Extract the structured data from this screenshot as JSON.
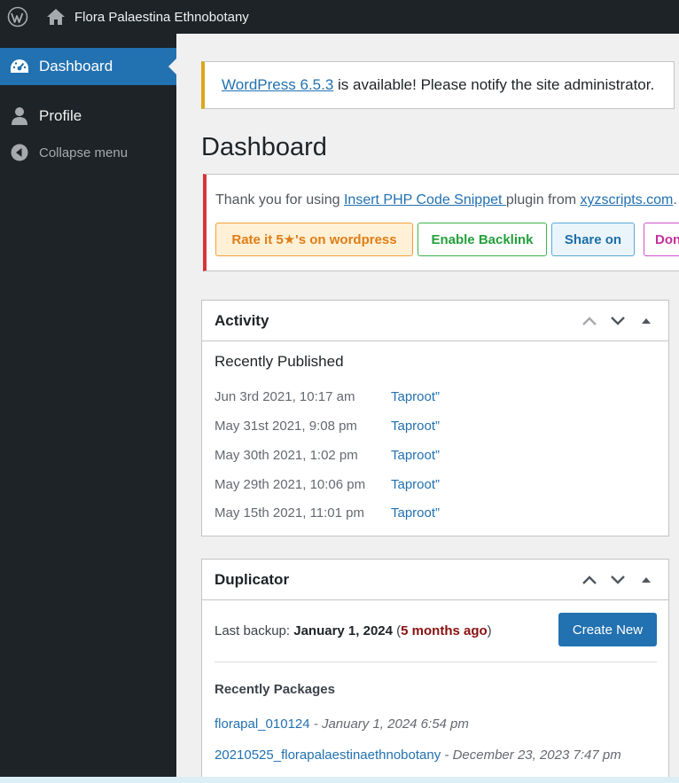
{
  "adminbar": {
    "site_name": "Flora Palaestina Ethnobotany",
    "icons": [
      "wordpress-logo-icon",
      "home-icon"
    ]
  },
  "sidebar": {
    "items": [
      {
        "label": "Dashboard",
        "icon": "dashboard-icon",
        "current": true
      },
      {
        "label": "Profile",
        "icon": "user-icon"
      },
      {
        "label": "Collapse menu",
        "icon": "collapse-icon"
      }
    ]
  },
  "update_notice": {
    "link": "WordPress 6.5.3",
    "text": " is available! Please notify the site administrator."
  },
  "page_title": "Dashboard",
  "plugin_notice": {
    "text_before": "Thank you for using ",
    "plugin_link": "Insert PHP Code Snippet ",
    "text_middle": "plugin from ",
    "site_link": "xyzscripts.com",
    "text_after": ".",
    "buttons": {
      "rate": "Rate it 5★'s on wordpress",
      "backlink": "Enable Backlink",
      "share": "Share on",
      "donate": "Don"
    }
  },
  "activity": {
    "title": "Activity",
    "subtitle": "Recently Published",
    "rows": [
      {
        "date": "Jun 3rd 2021, 10:17 am",
        "title": "Taproot”"
      },
      {
        "date": "May 31st 2021, 9:08 pm",
        "title": "Taproot”"
      },
      {
        "date": "May 30th 2021, 1:02 pm",
        "title": "Taproot”"
      },
      {
        "date": "May 29th 2021, 10:06 pm",
        "title": "Taproot”"
      },
      {
        "date": "May 15th 2021, 11:01 pm",
        "title": "Taproot”"
      }
    ]
  },
  "duplicator": {
    "title": "Duplicator",
    "backup_label": "Last backup: ",
    "backup_date": "January 1, 2024",
    "open_paren": " (",
    "ago": "5 months ago",
    "close_paren": ")",
    "create_button": "Create New",
    "recent_title": "Recently Packages",
    "packages": [
      {
        "name": "florapal_010124",
        "sep": " - ",
        "date": "January 1, 2024 6:54 pm"
      },
      {
        "name": "20210525_florapalaestinaethnobotany",
        "sep": " - ",
        "date": "December 23, 2023 7:47 pm"
      }
    ]
  },
  "colors": {
    "admin_dark": "#1d2327",
    "accent_blue": "#2271b1",
    "update_border": "#dba617",
    "error_border": "#d63638"
  }
}
